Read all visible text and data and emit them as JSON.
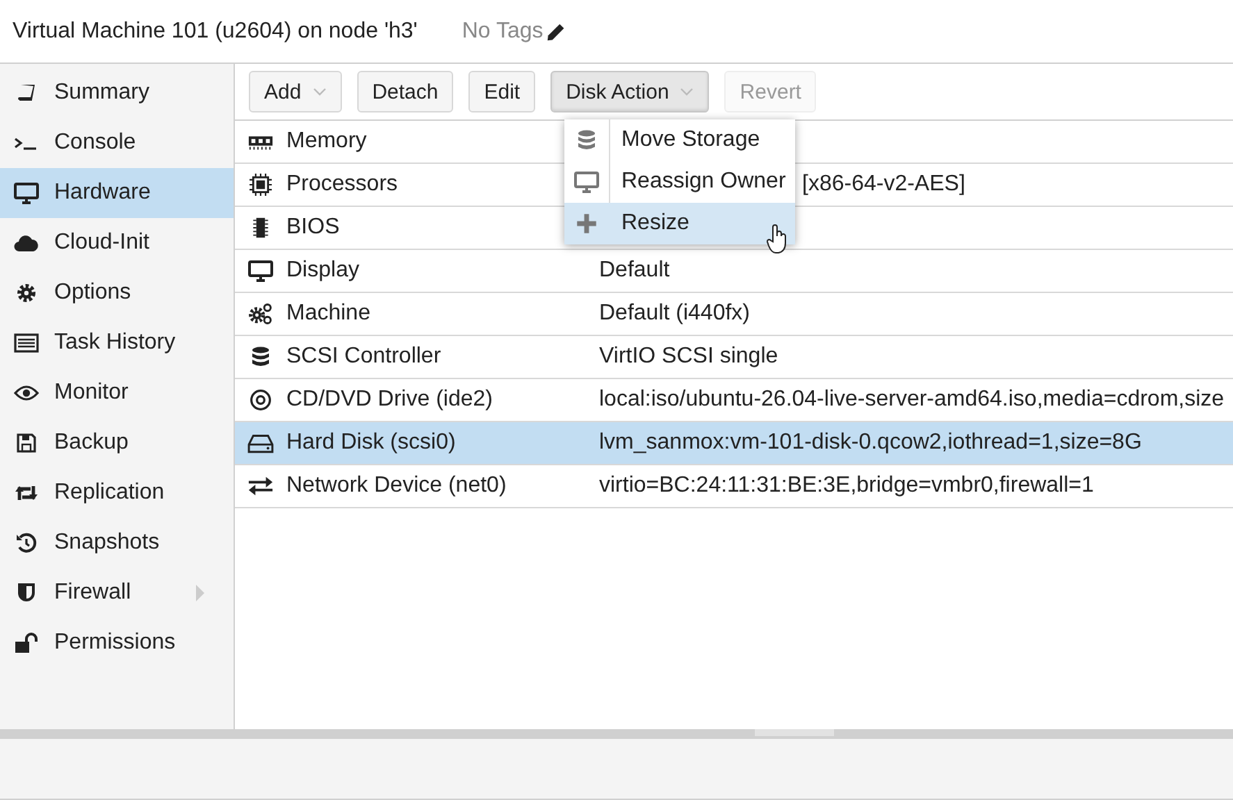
{
  "header": {
    "title": "Virtual Machine 101 (u2604) on node 'h3'",
    "tags": "No Tags"
  },
  "sidebar": {
    "items": [
      {
        "label": "Summary",
        "selected": false
      },
      {
        "label": "Console",
        "selected": false
      },
      {
        "label": "Hardware",
        "selected": true
      },
      {
        "label": "Cloud-Init",
        "selected": false
      },
      {
        "label": "Options",
        "selected": false
      },
      {
        "label": "Task History",
        "selected": false
      },
      {
        "label": "Monitor",
        "selected": false
      },
      {
        "label": "Backup",
        "selected": false
      },
      {
        "label": "Replication",
        "selected": false
      },
      {
        "label": "Snapshots",
        "selected": false
      },
      {
        "label": "Firewall",
        "selected": false,
        "expandable": true
      },
      {
        "label": "Permissions",
        "selected": false
      }
    ]
  },
  "toolbar": {
    "buttons": [
      {
        "label": "Add",
        "dropdown": true,
        "disabled": false,
        "pressed": false
      },
      {
        "label": "Detach",
        "dropdown": false,
        "disabled": false,
        "pressed": false
      },
      {
        "label": "Edit",
        "dropdown": false,
        "disabled": false,
        "pressed": false
      },
      {
        "label": "Disk Action",
        "dropdown": true,
        "disabled": false,
        "pressed": true
      },
      {
        "label": "Revert",
        "dropdown": false,
        "disabled": true,
        "pressed": false
      }
    ]
  },
  "menu": {
    "items": [
      {
        "label": "Move Storage",
        "selected": false
      },
      {
        "label": "Reassign Owner",
        "selected": false
      },
      {
        "label": "Resize",
        "selected": true
      }
    ]
  },
  "table": {
    "rows": [
      {
        "name": "Memory",
        "selected": false
      },
      {
        "name": "Processors",
        "value": "[x86-64-v2-AES]",
        "under_menu": true,
        "selected": false
      },
      {
        "name": "BIOS",
        "selected": false
      },
      {
        "name": "Display",
        "value": "Default",
        "selected": false
      },
      {
        "name": "Machine",
        "value": "Default (i440fx)",
        "selected": false
      },
      {
        "name": "SCSI Controller",
        "value": "VirtIO SCSI single",
        "selected": false
      },
      {
        "name": "CD/DVD Drive (ide2)",
        "value": "local:iso/ubuntu-26.04-live-server-amd64.iso,media=cdrom,size",
        "selected": false
      },
      {
        "name": "Hard Disk (scsi0)",
        "value": "lvm_sanmox:vm-101-disk-0.qcow2,iothread=1,size=8G",
        "selected": true
      },
      {
        "name": "Network Device (net0)",
        "value": "virtio=BC:24:11:31:BE:3E,bridge=vmbr0,firewall=1",
        "selected": false
      }
    ]
  }
}
